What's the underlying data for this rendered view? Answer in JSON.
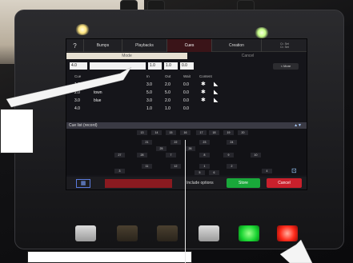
{
  "app": {
    "tabs": [
      "?",
      "Bumps",
      "Playbacks",
      "Cues",
      "Creation"
    ],
    "creation_sub": "Cr. Set\nCr. Set",
    "modes": [
      "Mode",
      "Cancel"
    ],
    "fields": [
      "4.0",
      "",
      "1.0",
      "1.0",
      "0.0"
    ],
    "more_label": "< More",
    "cue_columns": [
      "Cue",
      "In",
      "Out",
      "Wait",
      "Content"
    ],
    "cues": [
      {
        "cue": "1.0",
        "name": "",
        "in": "3.0",
        "out": "2.0",
        "wait": "0.0"
      },
      {
        "cue": "2.0",
        "name": "town",
        "in": "5.0",
        "out": "5.0",
        "wait": "0.0"
      },
      {
        "cue": "3.0",
        "name": "blue",
        "in": "3.0",
        "out": "2.0",
        "wait": "0.0"
      },
      {
        "cue": "4.0",
        "name": "",
        "in": "1.0",
        "out": "1.0",
        "wait": "0.0"
      }
    ],
    "cue_list_label": "Cue list (record)",
    "grid_numbers": [
      "13",
      "14",
      "15",
      "16",
      "17",
      "18",
      "19",
      "20",
      "21",
      "22",
      "23",
      "24",
      "25",
      "26",
      "27",
      "28",
      "7",
      "8",
      "9",
      "10",
      "11",
      "12",
      "1",
      "2",
      "3",
      "4",
      "5",
      "6"
    ],
    "include_options_label": "Include options",
    "store_label": "Store",
    "cancel_label": "Cancel",
    "colors": {
      "store": "#19a83a",
      "cancel": "#c9202c",
      "active_tab": "#3a1418"
    }
  }
}
